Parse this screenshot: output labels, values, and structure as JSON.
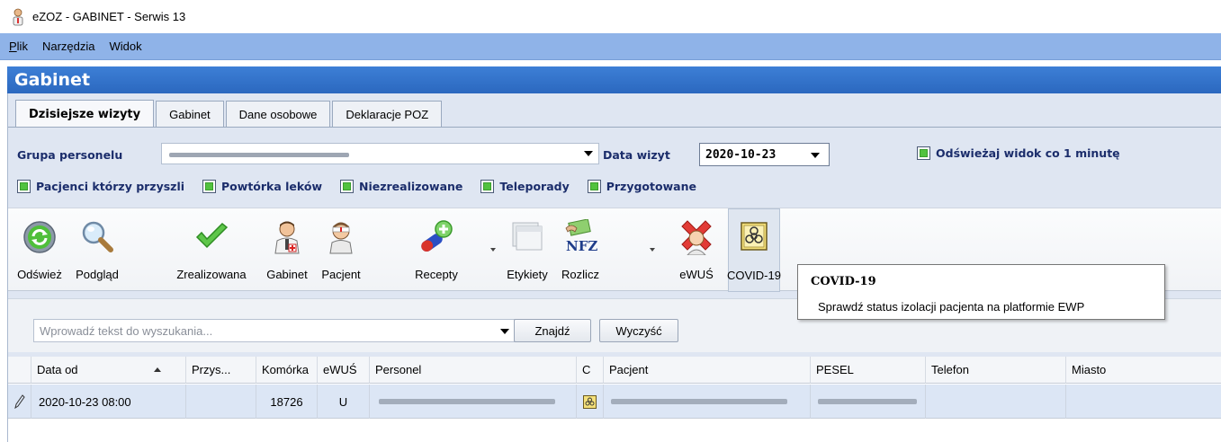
{
  "window": {
    "title": "eZOZ - GABINET - Serwis 13"
  },
  "menu": {
    "items": [
      {
        "label": "Plik",
        "accel": "P",
        "rest": "lik"
      },
      {
        "label": "Narzędzia"
      },
      {
        "label": "Widok"
      }
    ]
  },
  "header": {
    "title": "Gabinet"
  },
  "tabs": [
    "Dzisiejsze wizyty",
    "Gabinet",
    "Dane osobowe",
    "Deklaracje POZ"
  ],
  "filters": {
    "grupa_label": "Grupa personelu",
    "data_label": "Data wizyt",
    "data_value": "2020-10-23",
    "refresh_label": "Odświeżaj widok co 1 minutę",
    "checks": [
      "Pacjenci którzy przyszli",
      "Powtórka leków",
      "Niezrealizowane",
      "Teleporady",
      "Przygotowane"
    ]
  },
  "toolbar": {
    "buttons": [
      {
        "label": "Odśwież",
        "icon": "refresh-icon"
      },
      {
        "label": "Podgląd",
        "icon": "magnifier-icon"
      },
      {
        "label": "Zrealizowana",
        "icon": "checkmark-icon"
      },
      {
        "label": "Gabinet",
        "icon": "doctor-icon"
      },
      {
        "label": "Pacjent",
        "icon": "patient-icon"
      },
      {
        "label": "Recepty",
        "icon": "pills-icon"
      },
      {
        "label": "Etykiety",
        "icon": "labels-icon"
      },
      {
        "label": "Rozlicz",
        "icon": "nfz-icon"
      },
      {
        "label": "eWUŚ",
        "icon": "ewus-icon"
      },
      {
        "label": "COVID-19",
        "icon": "biohazard-icon"
      }
    ]
  },
  "tooltip": {
    "title": "COVID-19",
    "body": "Sprawdź status izolacji pacjenta na platformie EWP"
  },
  "search": {
    "placeholder": "Wprowadź tekst do wyszukania...",
    "find_label": "Znajdź",
    "clear_label": "Wyczyść"
  },
  "grid": {
    "columns": [
      "Data od",
      "Przys...",
      "Komórka",
      "eWUŚ",
      "Personel",
      "C",
      "Pacjent",
      "PESEL",
      "Telefon",
      "Miasto"
    ],
    "rows": [
      {
        "data_od": "2020-10-23 08:00",
        "przys": "",
        "komorka": "18726",
        "ewus": "U",
        "telefon": "",
        "miasto": ""
      }
    ]
  }
}
